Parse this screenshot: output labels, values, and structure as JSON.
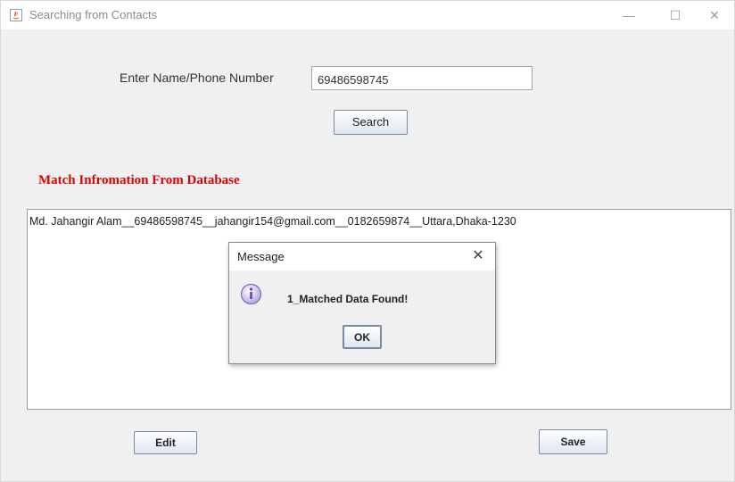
{
  "window": {
    "title": "Searching from Contacts",
    "controls": {
      "minimize": "—",
      "maximize": "☐",
      "close": "✕"
    }
  },
  "search": {
    "label": "Enter Name/Phone Number",
    "value": "69486598745",
    "button_label": "Search"
  },
  "results": {
    "heading": "Match Infromation From Database",
    "lines": [
      "Md. Jahangir Alam__69486598745__jahangir154@gmail.com__0182659874__Uttara,Dhaka-1230"
    ]
  },
  "dialog": {
    "title": "Message",
    "close": "✕",
    "icon": "info-icon",
    "message": "1_Matched Data Found!",
    "ok_label": "OK"
  },
  "actions": {
    "edit_label": "Edit",
    "save_label": "Save"
  }
}
